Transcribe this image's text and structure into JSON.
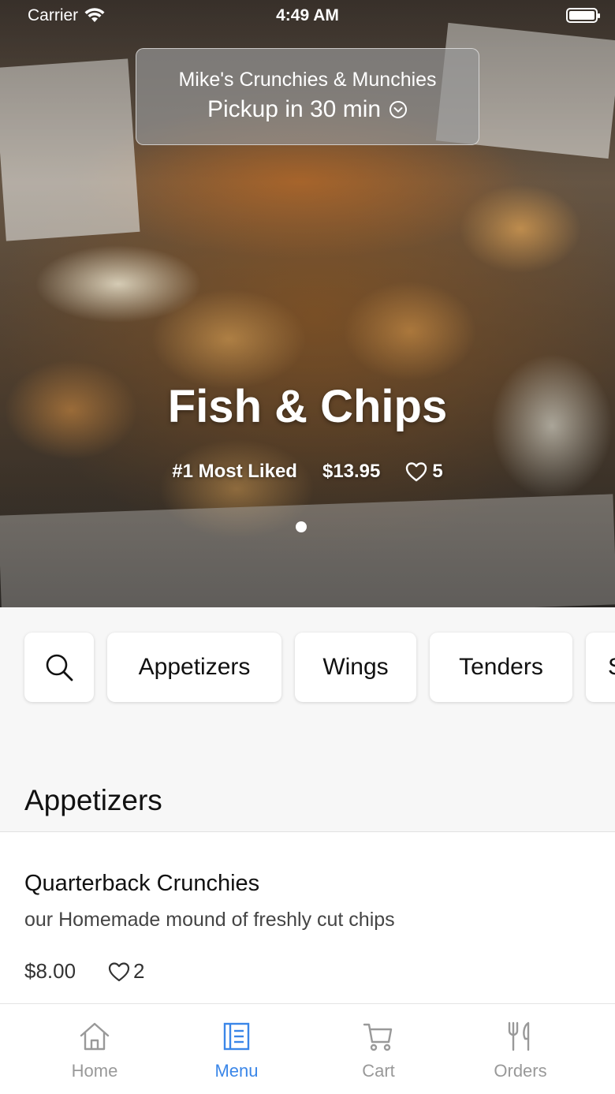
{
  "status_bar": {
    "carrier": "Carrier",
    "time": "4:49 AM"
  },
  "header": {
    "restaurant_name": "Mike's Crunchies & Munchies",
    "pickup_text": "Pickup in 30 min"
  },
  "featured": {
    "title": "Fish & Chips",
    "rank": "#1 Most Liked",
    "price": "$13.95",
    "likes": "5"
  },
  "categories": {
    "items": [
      "Appetizers",
      "Wings",
      "Tenders",
      "S"
    ]
  },
  "menu": {
    "section_title": "Appetizers",
    "items": [
      {
        "name": "Quarterback Crunchies",
        "description": "our Homemade mound of freshly cut chips",
        "price": "$8.00",
        "likes": "2"
      }
    ]
  },
  "tab_bar": {
    "tabs": [
      {
        "label": "Home",
        "icon": "home-icon"
      },
      {
        "label": "Menu",
        "icon": "menu-icon"
      },
      {
        "label": "Cart",
        "icon": "cart-icon"
      },
      {
        "label": "Orders",
        "icon": "utensils-icon"
      }
    ],
    "active": "Menu"
  },
  "colors": {
    "accent": "#3a86e8",
    "tab_inactive": "#999999",
    "background": "#f7f7f7"
  }
}
